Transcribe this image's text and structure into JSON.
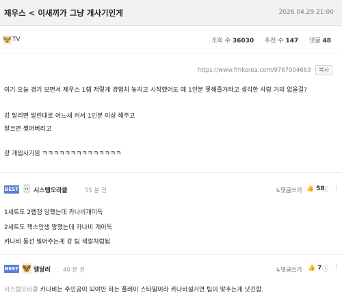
{
  "post": {
    "title": "제우스 < 이새끼가 그냥 개사기인게",
    "date": "2026.04.29 21:00",
    "author": "TV",
    "views_label": "조회 수",
    "views": "36030",
    "votes_label": "추천 수",
    "votes": "147",
    "comments_label": "댓글",
    "comments": "48",
    "url": "https://www.fmkorea.com/9767004663",
    "copy_label": "복사",
    "body": [
      "여기 오늘 경기 보면서 제우스 1렙 저렇게 경험치 놓치고 시작했어도 예 1인분 못해줄거라고 생각한 사람 거의 없을걸?",
      "강 말리면 말린대로 어느새 커서 1인분 이상 해주고",
      "잘크면 찢어버리고",
      "강 개씹사기임 ㅋㅋㅋㅋㅋㅋㅋㅋㅋㅋㅋㅋㅋㅋ"
    ]
  },
  "comments": [
    {
      "badge": "BEST",
      "nickname": "시스템오라클",
      "time": "55 분 전",
      "reply_label": "↳댓글쓰기",
      "likes": "58",
      "lines": [
        "1세트도 2렙갱 당했는데 카나비개이득",
        "2세트도 잭스인생 망했는데 카나비 개이득",
        "카나비 동선 밀어주는게 강 팀 색깔처럼됨"
      ]
    },
    {
      "badge": "BEST",
      "nickname": "엘달러",
      "time": "40 분 전",
      "reply_label": "↳댓글쓰기",
      "likes": "7",
      "ref": "시스템오라클",
      "text": "카나비는 주인공이 되야만 하는 플레이 스타일이라 카나비설거면 팀이 맞추는게 낫긴함."
    }
  ],
  "icons": {
    "thumb": "thumbs-up-icon",
    "more": "more-vertical-icon",
    "avatar": "dog-avatar-icon"
  },
  "colors": {
    "best_badge": "#5b7fd6",
    "title_bar": "#f2f2f2"
  }
}
